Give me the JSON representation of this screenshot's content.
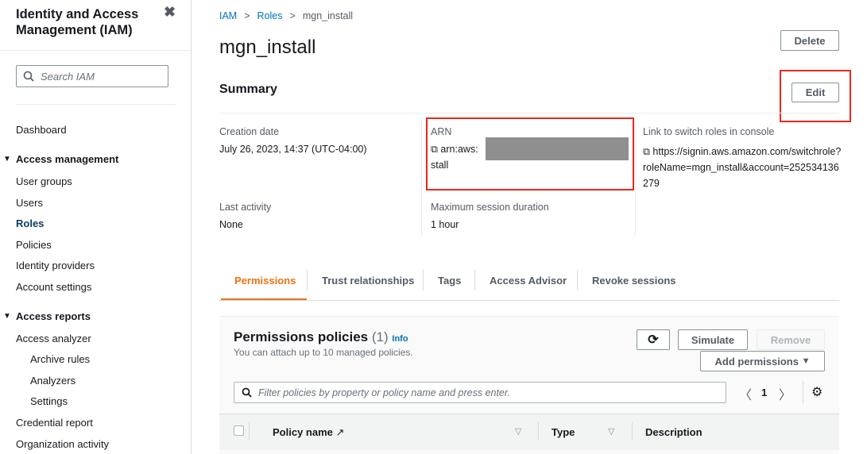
{
  "sidebar": {
    "title_line1": "Identity and Access",
    "title_line2": "Management (IAM)",
    "search_placeholder": "Search IAM",
    "items": [
      "Dashboard",
      "Access management",
      "User groups",
      "Users",
      "Roles",
      "Policies",
      "Identity providers",
      "Account settings",
      "Access reports",
      "Access analyzer",
      "Archive rules",
      "Analyzers",
      "Settings",
      "Credential report",
      "Organization activity"
    ]
  },
  "breadcrumb": [
    "IAM",
    "Roles",
    "mgn_install"
  ],
  "title": "mgn_install",
  "delete_label": "Delete",
  "edit_label": "Edit",
  "summary": {
    "heading": "Summary",
    "creation_label": "Creation date",
    "creation_value": "July 26, 2023, 14:37 (UTC-04:00)",
    "arn_label": "ARN",
    "arn_value_start": "arn:aws:",
    "arn_value_end": "stall",
    "link_label": "Link to switch roles in console",
    "link_value": "https://signin.aws.amazon.com/switchrole?roleName=mgn_install&account=252534136279",
    "last_label": "Last activity",
    "last_value": "None",
    "max_label": "Maximum session duration",
    "max_value": "1 hour"
  },
  "tabs": [
    "Permissions",
    "Trust relationships",
    "Tags",
    "Access Advisor",
    "Revoke sessions"
  ],
  "policies": {
    "heading": "Permissions policies",
    "count": "(1)",
    "info": "Info",
    "sub": "You can attach up to 10 managed policies.",
    "simulate": "Simulate",
    "remove": "Remove",
    "add": "Add permissions",
    "filter_placeholder": "Filter policies by property or policy name and press enter.",
    "page": "1",
    "columns": [
      "Policy name",
      "Type",
      "Description"
    ]
  },
  "colors": {
    "accent": "#ec7211",
    "link": "#0073bb",
    "highlight": "#e8281c"
  }
}
